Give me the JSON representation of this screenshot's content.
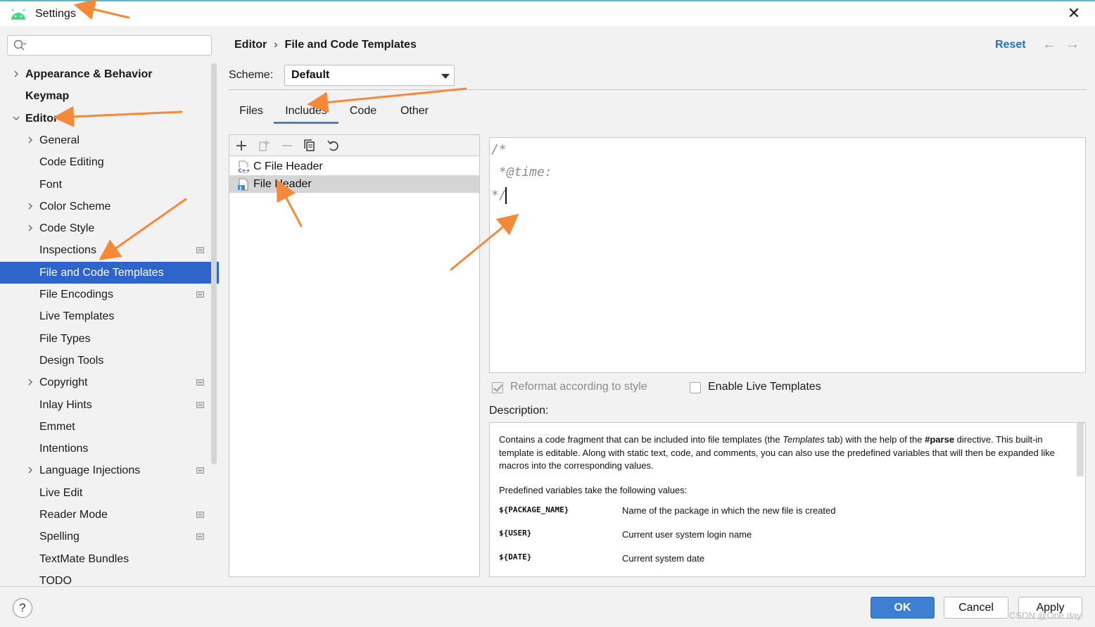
{
  "window": {
    "title": "Settings"
  },
  "colors": {
    "accent": "#2f65ca",
    "link": "#2470c6",
    "ok_button": "#3c7fd3",
    "annotation_arrow": "#f5893a"
  },
  "sidebar": {
    "search_placeholder": "",
    "items": [
      {
        "label": "Appearance & Behavior",
        "level": 0,
        "expandable": true,
        "expanded": false,
        "bold": true,
        "badge": false
      },
      {
        "label": "Keymap",
        "level": 0,
        "expandable": false,
        "bold": true,
        "badge": false
      },
      {
        "label": "Editor",
        "level": 0,
        "expandable": true,
        "expanded": true,
        "bold": true,
        "badge": false
      },
      {
        "label": "General",
        "level": 1,
        "expandable": true,
        "expanded": false,
        "badge": false
      },
      {
        "label": "Code Editing",
        "level": 1,
        "expandable": false,
        "badge": false
      },
      {
        "label": "Font",
        "level": 1,
        "expandable": false,
        "badge": false
      },
      {
        "label": "Color Scheme",
        "level": 1,
        "expandable": true,
        "expanded": false,
        "badge": false
      },
      {
        "label": "Code Style",
        "level": 1,
        "expandable": true,
        "expanded": false,
        "badge": false
      },
      {
        "label": "Inspections",
        "level": 1,
        "expandable": false,
        "badge": true
      },
      {
        "label": "File and Code Templates",
        "level": 1,
        "expandable": false,
        "badge": false,
        "selected": true
      },
      {
        "label": "File Encodings",
        "level": 1,
        "expandable": false,
        "badge": true
      },
      {
        "label": "Live Templates",
        "level": 1,
        "expandable": false,
        "badge": false
      },
      {
        "label": "File Types",
        "level": 1,
        "expandable": false,
        "badge": false
      },
      {
        "label": "Design Tools",
        "level": 1,
        "expandable": false,
        "badge": false
      },
      {
        "label": "Copyright",
        "level": 1,
        "expandable": true,
        "expanded": false,
        "badge": true
      },
      {
        "label": "Inlay Hints",
        "level": 1,
        "expandable": false,
        "badge": true
      },
      {
        "label": "Emmet",
        "level": 1,
        "expandable": false,
        "badge": false
      },
      {
        "label": "Intentions",
        "level": 1,
        "expandable": false,
        "badge": false
      },
      {
        "label": "Language Injections",
        "level": 1,
        "expandable": true,
        "expanded": false,
        "badge": true
      },
      {
        "label": "Live Edit",
        "level": 1,
        "expandable": false,
        "badge": false
      },
      {
        "label": "Reader Mode",
        "level": 1,
        "expandable": false,
        "badge": true
      },
      {
        "label": "Spelling",
        "level": 1,
        "expandable": false,
        "badge": true
      },
      {
        "label": "TextMate Bundles",
        "level": 1,
        "expandable": false,
        "badge": false
      },
      {
        "label": "TODO",
        "level": 1,
        "expandable": false,
        "badge": false
      }
    ]
  },
  "header": {
    "breadcrumb_parent": "Editor",
    "breadcrumb_separator": "›",
    "breadcrumb_current": "File and Code Templates",
    "reset_label": "Reset",
    "back_icon": "←",
    "forward_icon": "→"
  },
  "scheme": {
    "label": "Scheme:",
    "value": "Default"
  },
  "tabs": [
    {
      "label": "Files",
      "active": false
    },
    {
      "label": "Includes",
      "active": true
    },
    {
      "label": "Code",
      "active": false
    },
    {
      "label": "Other",
      "active": false
    }
  ],
  "template_list": {
    "toolbar": [
      "add-icon",
      "add-child-icon",
      "remove-icon",
      "copy-icon",
      "reset-icon"
    ],
    "items": [
      {
        "label": "C File Header",
        "icon": "cpp-file-icon",
        "selected": false
      },
      {
        "label": "File Header",
        "icon": "java-file-icon",
        "selected": true
      }
    ]
  },
  "editor": {
    "lines": [
      "/*",
      " *@time:",
      "*/"
    ]
  },
  "options": {
    "reformat": {
      "label": "Reformat according to style",
      "checked": true,
      "disabled": true
    },
    "live_templates": {
      "label": "Enable Live Templates",
      "checked": false,
      "disabled": false
    }
  },
  "description": {
    "label": "Description:",
    "p1_a": "Contains a code fragment that can be included into file templates (the ",
    "p1_em": "Templates",
    "p1_b": " tab) with the help of the ",
    "p1_strong": "#parse",
    "p1_c": " directive. This built-in template is editable. Along with static text, code, and comments, you can also use the predefined variables that will then be expanded like macros into the corresponding values.",
    "predefined": "Predefined variables take the following values:",
    "variables": [
      {
        "name": "${PACKAGE_NAME}",
        "desc": "Name of the package in which the new file is created"
      },
      {
        "name": "${USER}",
        "desc": "Current user system login name"
      },
      {
        "name": "${DATE}",
        "desc": "Current system date"
      }
    ]
  },
  "buttons": {
    "ok": "OK",
    "cancel": "Cancel",
    "apply": "Apply",
    "help": "?"
  },
  "watermark": "CSDN @One day"
}
